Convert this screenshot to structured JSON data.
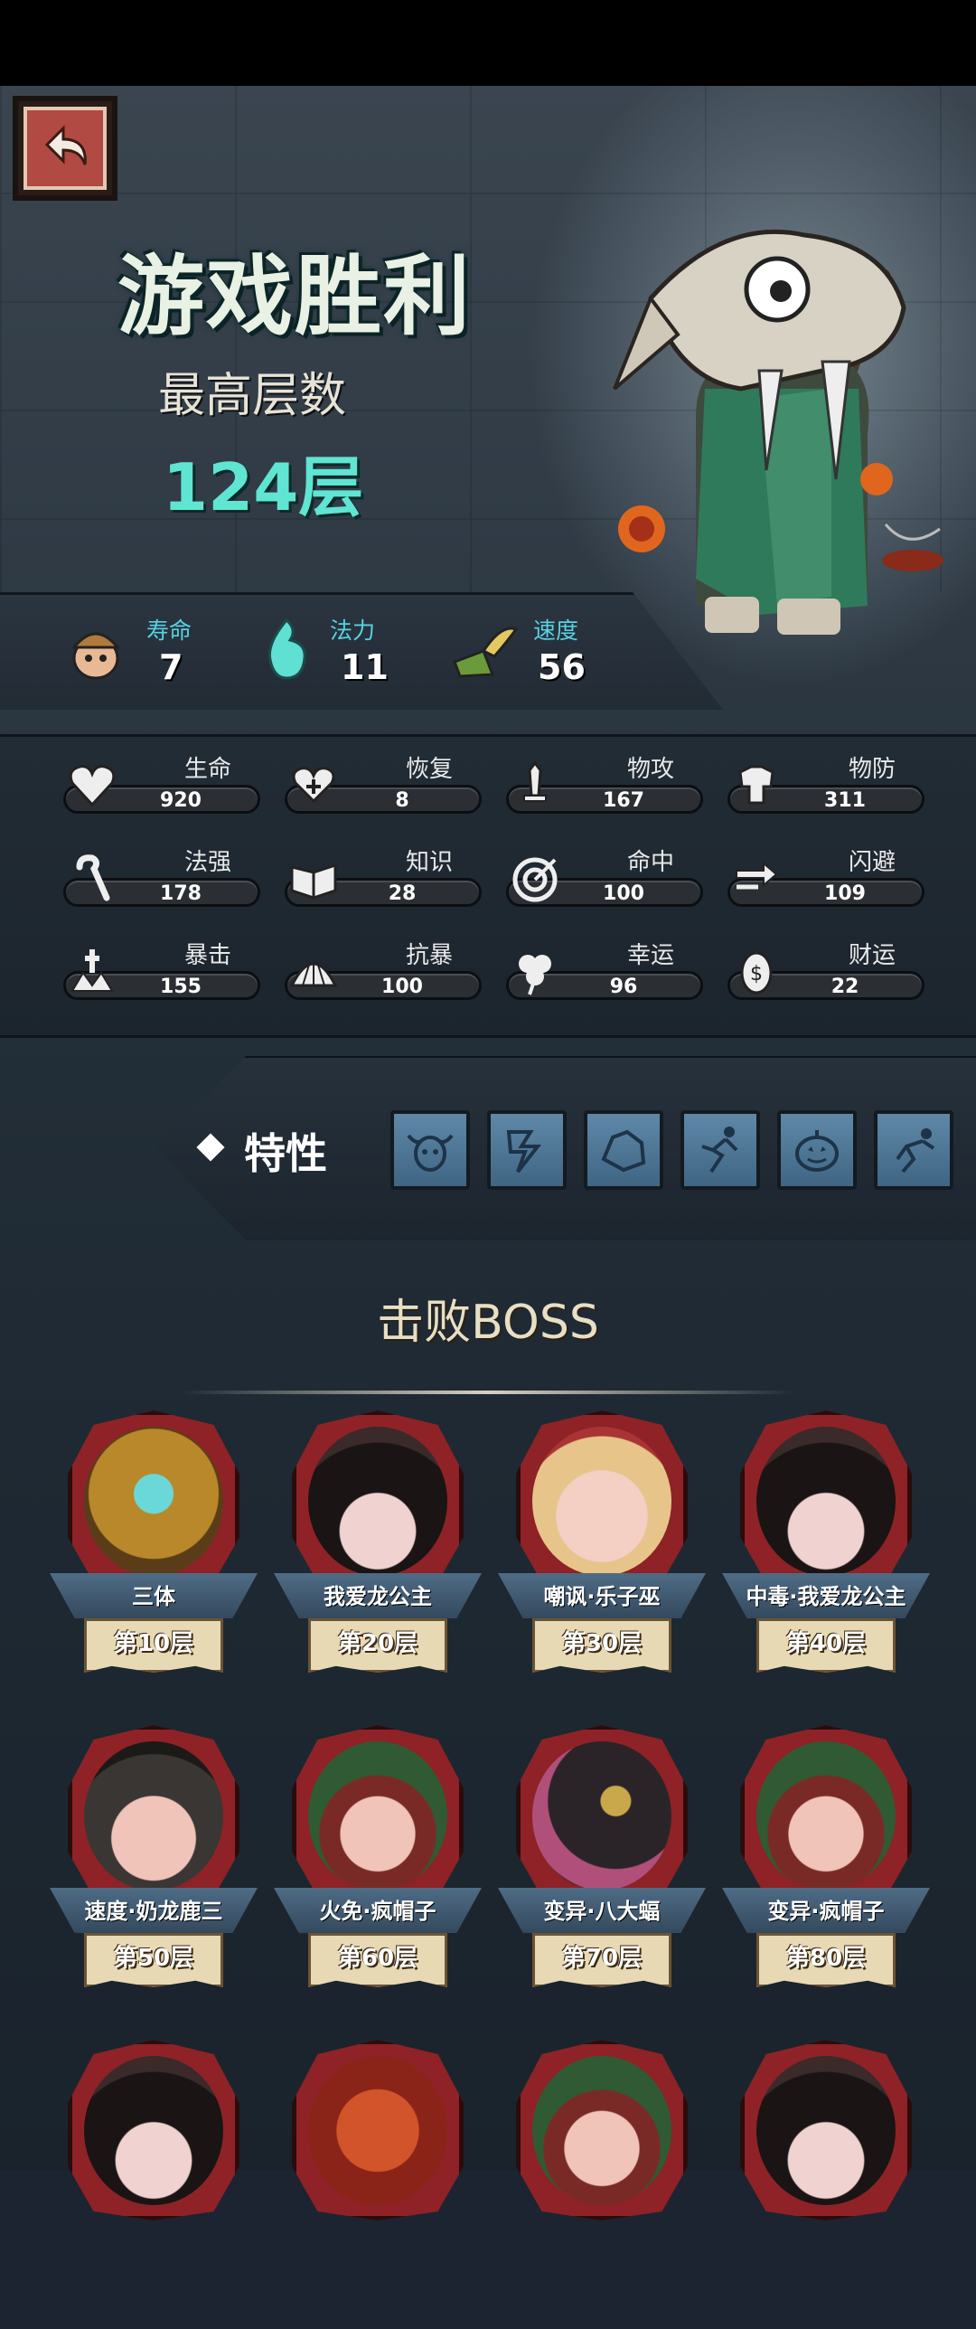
{
  "header": {
    "title": "游戏胜利",
    "max_floor_label": "最高层数",
    "max_floor_value": "124层"
  },
  "top_stats": [
    {
      "label": "寿命",
      "value": "7",
      "icon": "miner-icon"
    },
    {
      "label": "法力",
      "value": "11",
      "icon": "mana-flame-icon"
    },
    {
      "label": "速度",
      "value": "56",
      "icon": "winged-boot-icon"
    }
  ],
  "attributes": [
    {
      "label": "生命",
      "value": "920",
      "icon": "heart-icon"
    },
    {
      "label": "恢复",
      "value": "8",
      "icon": "heal-heart-icon"
    },
    {
      "label": "物攻",
      "value": "167",
      "icon": "sword-icon"
    },
    {
      "label": "物防",
      "value": "311",
      "icon": "armor-icon"
    },
    {
      "label": "法强",
      "value": "178",
      "icon": "staff-icon"
    },
    {
      "label": "知识",
      "value": "28",
      "icon": "book-icon"
    },
    {
      "label": "命中",
      "value": "100",
      "icon": "target-icon"
    },
    {
      "label": "闪避",
      "value": "109",
      "icon": "dodge-arrows-icon"
    },
    {
      "label": "暴击",
      "value": "155",
      "icon": "crit-icon"
    },
    {
      "label": "抗暴",
      "value": "100",
      "icon": "shell-icon"
    },
    {
      "label": "幸运",
      "value": "96",
      "icon": "clover-icon"
    },
    {
      "label": "财运",
      "value": "22",
      "icon": "coin-icon"
    }
  ],
  "traits": {
    "label": "特性",
    "icons": [
      "bull-trait-icon",
      "lightning-trait-icon",
      "rock-trait-icon",
      "runner-trait-icon",
      "pumpkin-trait-icon",
      "leap-trait-icon"
    ]
  },
  "bosses": {
    "title": "击败BOSS",
    "items": [
      {
        "name": "三体",
        "floor": "第10层"
      },
      {
        "name": "我爱龙公主",
        "floor": "第20层"
      },
      {
        "name": "嘲讽·乐子巫",
        "floor": "第30层"
      },
      {
        "name": "中毒·我爱龙公主",
        "floor": "第40层"
      },
      {
        "name": "速度·奶龙鹿三",
        "floor": "第50层"
      },
      {
        "name": "火免·疯帽子",
        "floor": "第60层"
      },
      {
        "name": "变异·八大蝠",
        "floor": "第70层"
      },
      {
        "name": "变异·疯帽子",
        "floor": "第80层"
      }
    ]
  },
  "colors": {
    "accent_cyan": "#5fe5d2",
    "label_blue": "#58d2e4",
    "boss_frame_red": "#8e2226"
  }
}
